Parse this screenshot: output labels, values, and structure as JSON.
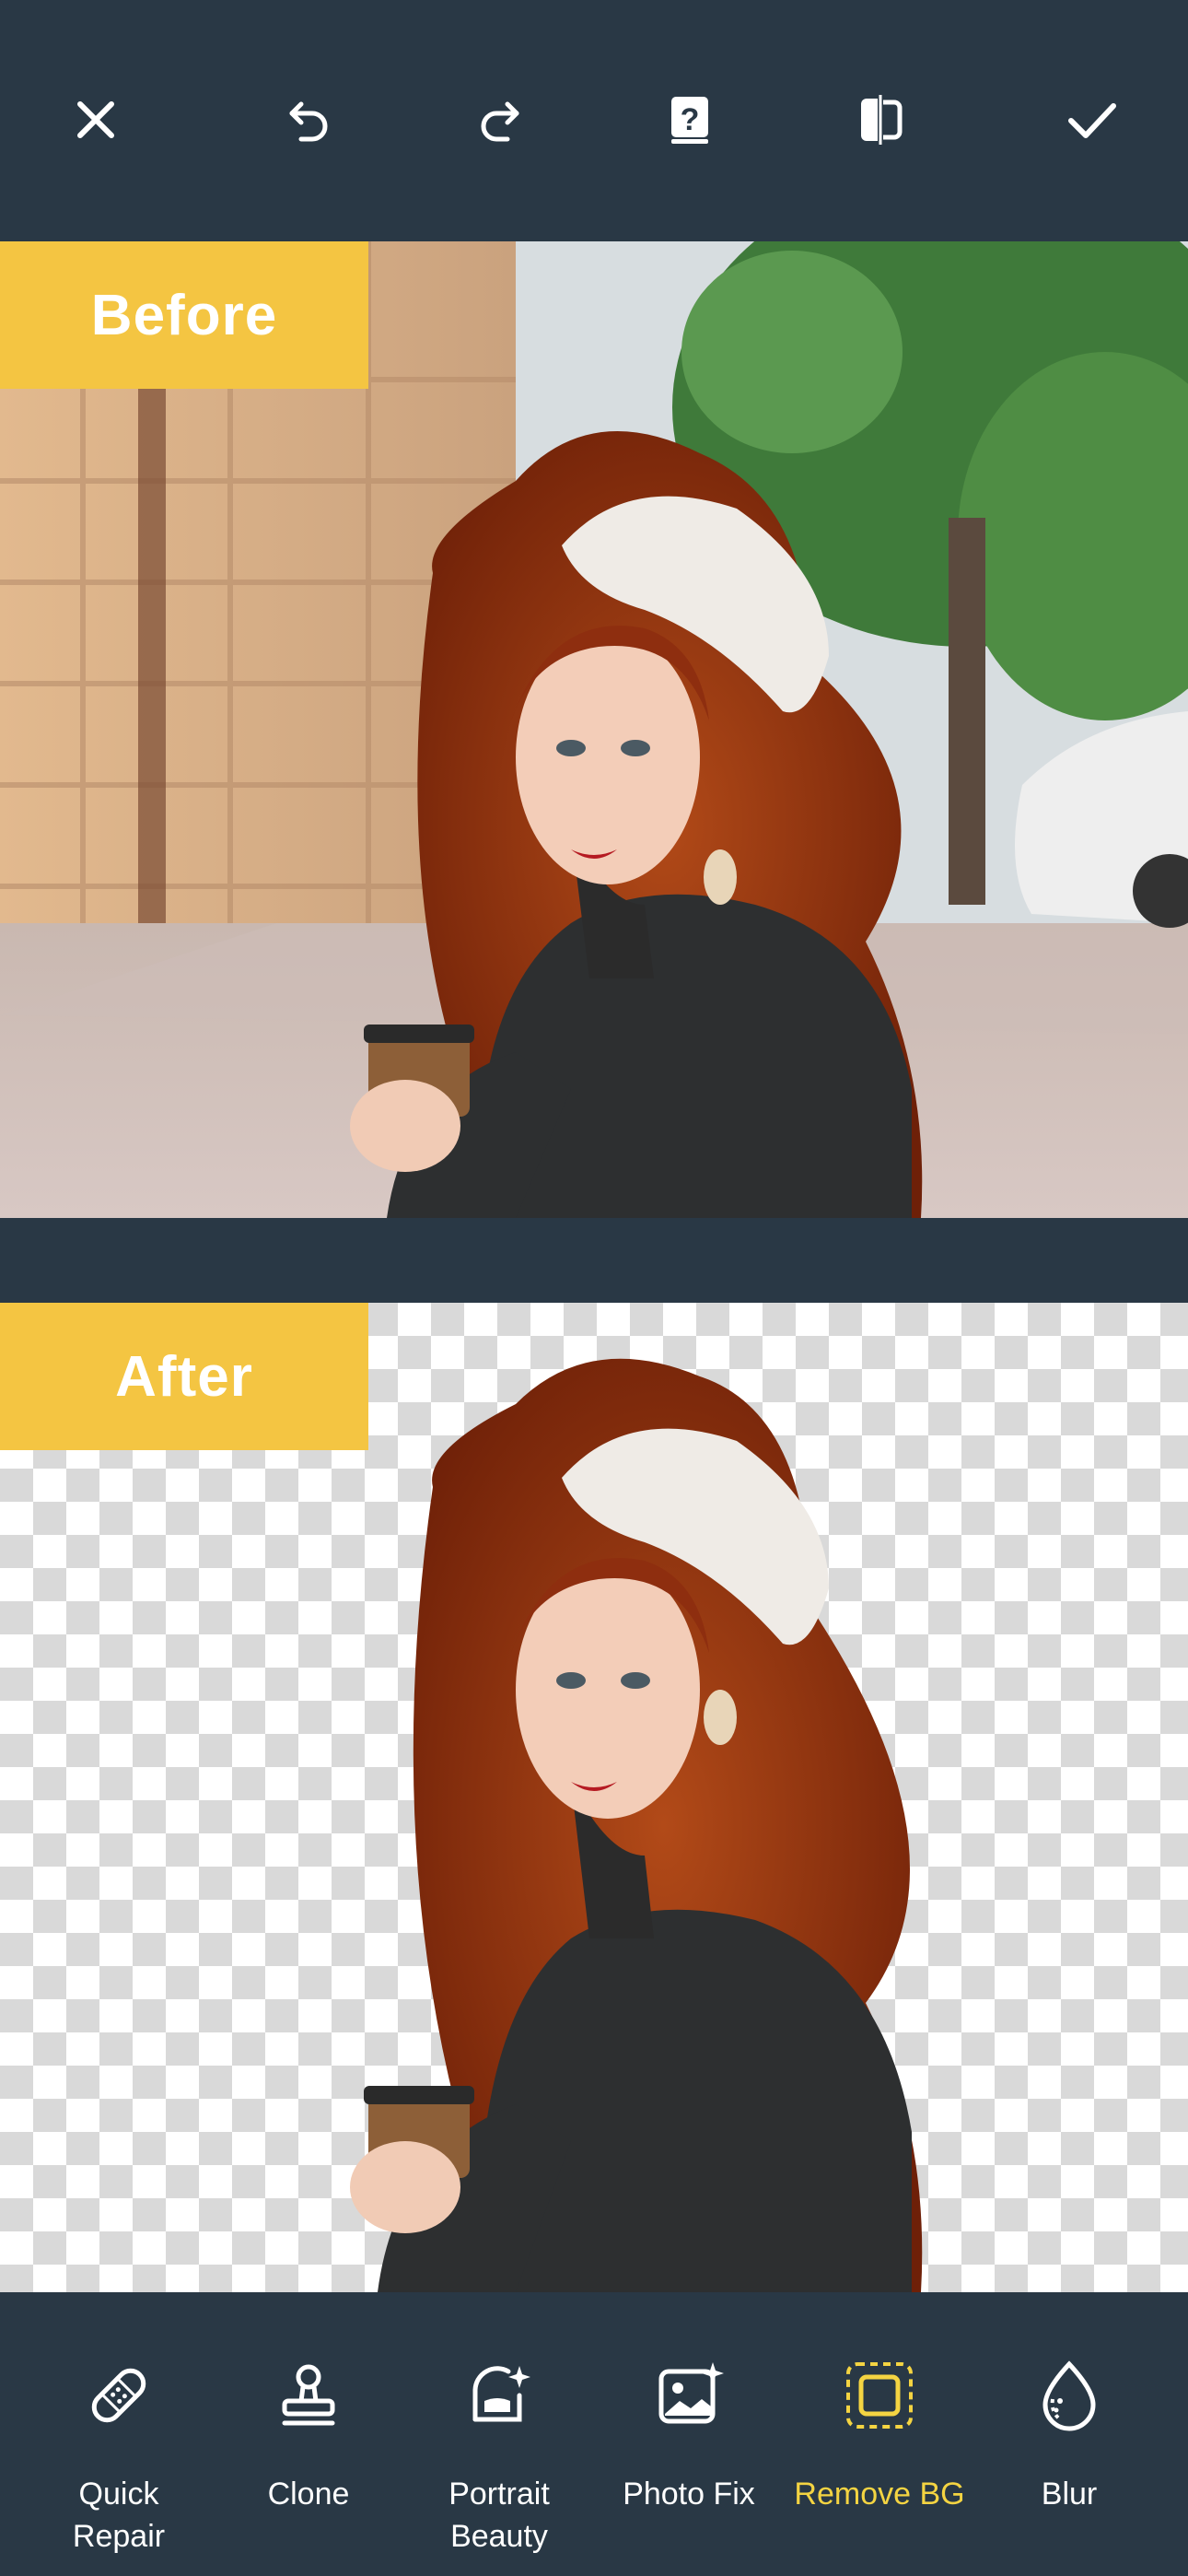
{
  "top_toolbar": {
    "close": "close-icon",
    "undo": "undo-icon",
    "redo": "redo-icon",
    "help": "help-icon",
    "compare": "compare-icon",
    "confirm": "check-icon"
  },
  "before": {
    "label": "Before"
  },
  "after": {
    "label": "After"
  },
  "tools": [
    {
      "label": "Quick\nRepair",
      "icon": "bandage-icon",
      "active": false
    },
    {
      "label": "Clone",
      "icon": "stamp-icon",
      "active": false
    },
    {
      "label": "Portrait\nBeauty",
      "icon": "portrait-beauty-icon",
      "active": false
    },
    {
      "label": "Photo Fix",
      "icon": "photo-fix-icon",
      "active": false
    },
    {
      "label": "Remove BG",
      "icon": "remove-bg-icon",
      "active": true
    },
    {
      "label": "Blur",
      "icon": "blur-icon",
      "active": false
    }
  ],
  "colors": {
    "background": "#293845",
    "tag": "#f4c542",
    "active_tool": "#f4d442"
  }
}
